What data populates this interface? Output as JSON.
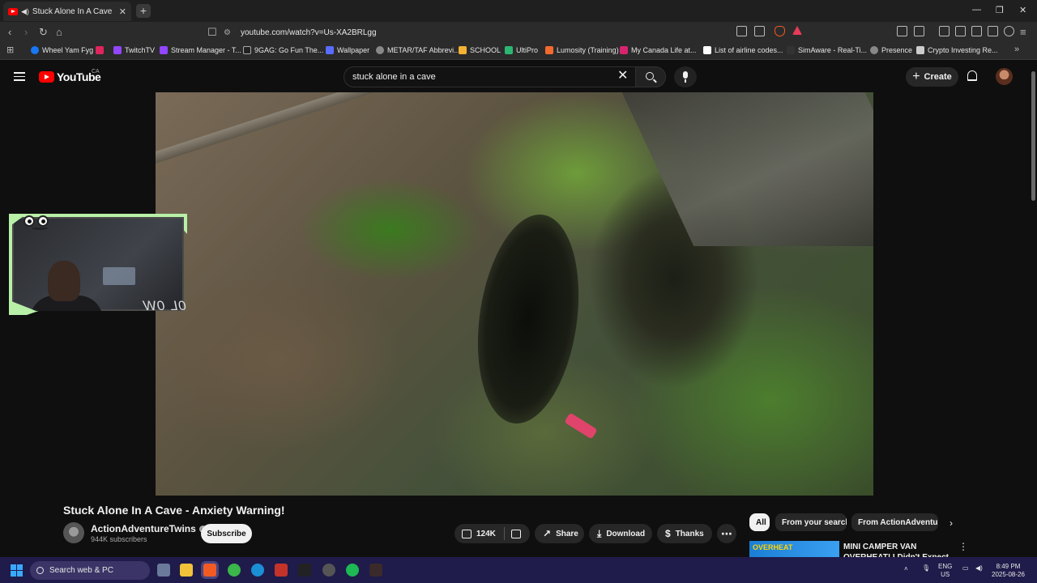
{
  "browser": {
    "tab": {
      "title": "Stuck Alone In A Cave - Anxiety Warning! - YouTube",
      "icon": "youtube-favicon",
      "audio_icon": "speaker-icon"
    },
    "url": "youtube.com/watch?v=Us-XA2BRLgg",
    "bookmarks": [
      {
        "label": "Wheel Yam Fyg",
        "color": "#1877f2"
      },
      {
        "label": "",
        "color": "#e0245e"
      },
      {
        "label": "TwitchTV",
        "color": "#9146ff"
      },
      {
        "label": "Stream Manager - T...",
        "color": "#9146ff"
      },
      {
        "label": "9GAG: Go Fun The...",
        "color": "#222222"
      },
      {
        "label": "Wallpaper",
        "color": "#5a6cff"
      },
      {
        "label": "METAR/TAF Abbrevi...",
        "color": "#888888"
      },
      {
        "label": "SCHOOL",
        "color": "#f2b233"
      },
      {
        "label": "UltiPro",
        "color": "#2bb673"
      },
      {
        "label": "Lumosity (Training)",
        "color": "#f26a2e"
      },
      {
        "label": "My Canada Life at...",
        "color": "#d6246e"
      },
      {
        "label": "List of airline codes...",
        "color": "#ffffff"
      },
      {
        "label": "SimAware - Real-Ti...",
        "color": "#333333"
      },
      {
        "label": "Presence",
        "color": "#888888"
      },
      {
        "label": "Crypto Investing Re...",
        "color": "#cccccc"
      }
    ]
  },
  "youtube": {
    "logo_text": "YouTube",
    "region": "CA",
    "search_value": "stuck alone in a cave",
    "create_label": "Create",
    "video": {
      "title": "Stuck Alone In A Cave - Anxiety Warning!",
      "channel": "ActionAdventureTwins",
      "subscribers": "944K subscribers",
      "subscribe_label": "Subscribe",
      "likes": "124K",
      "share_label": "Share",
      "download_label": "Download",
      "thanks_label": "Thanks"
    },
    "overlay_text": "0L 0W",
    "chips": [
      "All",
      "From your search",
      "From ActionAdventureTwins"
    ],
    "recommendation": {
      "thumb_text": "OVERHEAT",
      "title": "MINI CAMPER VAN OVERHEAT! I Didn't Expect THIS 😱"
    }
  },
  "taskbar": {
    "search_placeholder": "Search web & PC",
    "lang": "ENG",
    "region": "US",
    "time": "8:49 PM",
    "date": "2025-08-26"
  }
}
